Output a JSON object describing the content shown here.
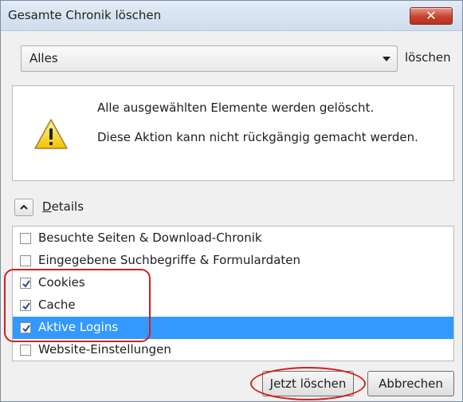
{
  "window": {
    "title": "Gesamte Chronik löschen",
    "close_label": "✕"
  },
  "timerange": {
    "selected": "Alles",
    "suffix": "löschen"
  },
  "warning": {
    "line1": "Alle ausgewählten Elemente werden gelöscht.",
    "line2": "Diese Aktion kann nicht rückgängig gemacht werden."
  },
  "details": {
    "label_first": "D",
    "label_rest": "etails"
  },
  "items": [
    {
      "label": "Besuchte Seiten & Download-Chronik",
      "checked": false,
      "selected": false
    },
    {
      "label": "Eingegebene Suchbegriffe & Formulardaten",
      "checked": false,
      "selected": false
    },
    {
      "label": "Cookies",
      "checked": true,
      "selected": false
    },
    {
      "label": "Cache",
      "checked": true,
      "selected": false
    },
    {
      "label": "Aktive Logins",
      "checked": true,
      "selected": true
    },
    {
      "label": "Website-Einstellungen",
      "checked": false,
      "selected": false
    }
  ],
  "buttons": {
    "ok": "Jetzt löschen",
    "cancel": "Abbrechen"
  },
  "colors": {
    "selection": "#3399ff",
    "annotation": "#d11f1f",
    "close": "#c5432d"
  }
}
